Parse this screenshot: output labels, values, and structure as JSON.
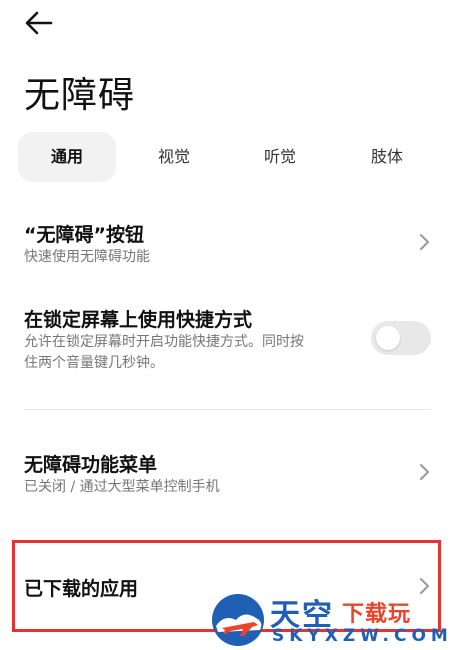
{
  "header": {
    "back_icon": "back-arrow-icon",
    "title": "无障碍"
  },
  "tabs": [
    {
      "label": "通用",
      "active": true
    },
    {
      "label": "视觉",
      "active": false
    },
    {
      "label": "听觉",
      "active": false
    },
    {
      "label": "肢体",
      "active": false
    }
  ],
  "settings": {
    "button": {
      "title": "“无障碍”按钮",
      "subtitle": "快速使用无障碍功能"
    },
    "lockscreen": {
      "title": "在锁定屏幕上使用快捷方式",
      "subtitle_line1": "允许在锁定屏幕时开启功能快捷方式。同时按",
      "subtitle_line2": "住两个音量键几秒钟。",
      "enabled": false
    },
    "menu": {
      "title": "无障碍功能菜单",
      "subtitle": "已关闭 / 通过大型菜单控制手机"
    },
    "downloaded": {
      "title": "已下载的应用"
    }
  },
  "watermark": {
    "brand_cn": "天空",
    "brand_tag": "下载玩",
    "domain": "SKYXZW.COM"
  },
  "colors": {
    "highlight_box": "#e53333",
    "toggle_off": "#e8e8e8",
    "watermark_blue": "#1f5fb4",
    "watermark_red": "#e8452c"
  }
}
